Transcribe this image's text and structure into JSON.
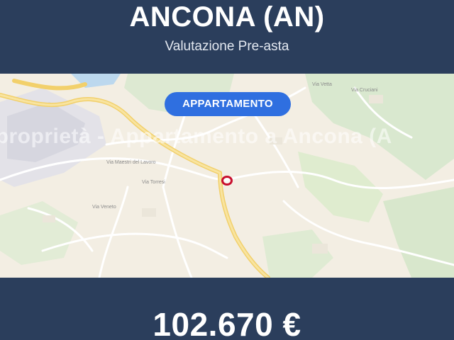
{
  "header": {
    "title": "ANCONA (AN)",
    "subtitle": "Valutazione Pre-asta"
  },
  "map": {
    "badge_label": "APPARTAMENTO",
    "watermark": "ida proprietà - Appartamento a Ancona (A",
    "pin_icon": "location-marker-icon"
  },
  "footer": {
    "price": "102.670 €"
  },
  "colors": {
    "background": "#2b3e5c",
    "badge": "#2f6fe0",
    "pin": "#c8102e",
    "map_land": "#f3eee3",
    "map_green": "#d9e8cf",
    "road_main": "#f7dc8a"
  }
}
